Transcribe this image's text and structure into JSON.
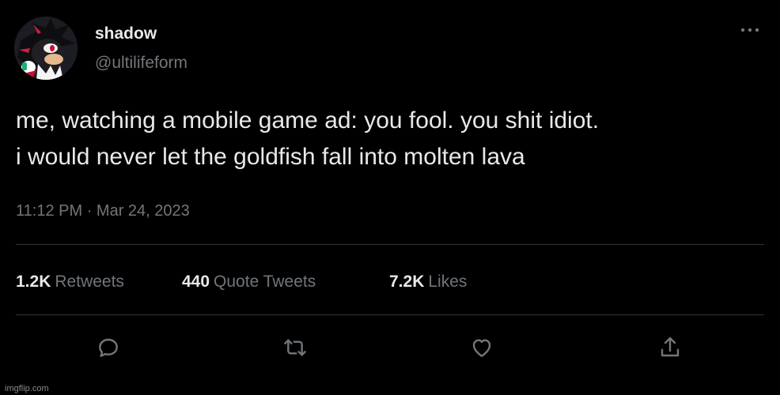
{
  "user": {
    "display_name": "shadow",
    "handle": "@ultilifeform",
    "avatar_icon": "hedgehog-avatar"
  },
  "tweet": {
    "lines": [
      "me, watching a mobile game ad: you fool. you shit idiot.",
      "i would never let the goldfish fall into molten lava"
    ],
    "time": "11:12 PM",
    "separator": "·",
    "date": "Mar 24, 2023"
  },
  "stats": {
    "retweets": {
      "count": "1.2K",
      "label": "Retweets"
    },
    "quotes": {
      "count": "440",
      "label": "Quote Tweets"
    },
    "likes": {
      "count": "7.2K",
      "label": "Likes"
    }
  },
  "actions": {
    "reply_icon": "reply-icon",
    "retweet_icon": "retweet-icon",
    "like_icon": "heart-icon",
    "share_icon": "share-icon",
    "more_icon": "more-icon"
  },
  "colors": {
    "background": "#000000",
    "primary_text": "#e7e9ea",
    "secondary_text": "#71767b",
    "divider": "#2f3336"
  },
  "watermark": "imgflip.com"
}
